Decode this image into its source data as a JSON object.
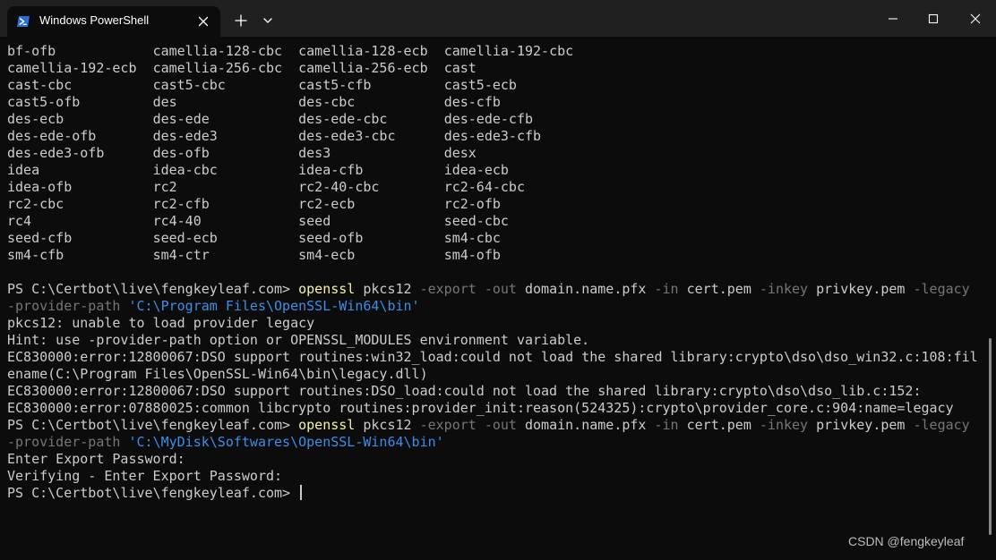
{
  "window": {
    "tab_title": "Windows PowerShell",
    "icons": {
      "tab": "powershell-icon",
      "tab_close": "close-icon",
      "new_tab": "plus-icon",
      "dropdown": "chevron-down-icon",
      "minimize": "minimize-icon",
      "maximize": "maximize-icon",
      "close": "close-icon"
    },
    "colors": {
      "titlebar": "#202020",
      "background": "#0c0c0c",
      "text": "#cccccc",
      "command": "#f9f1a5",
      "parameter": "#767676",
      "string": "#3b8eea"
    }
  },
  "cipher_table": [
    [
      "bf-ofb",
      "camellia-128-cbc",
      "camellia-128-ecb",
      "camellia-192-cbc"
    ],
    [
      "camellia-192-ecb",
      "camellia-256-cbc",
      "camellia-256-ecb",
      "cast"
    ],
    [
      "cast-cbc",
      "cast5-cbc",
      "cast5-cfb",
      "cast5-ecb"
    ],
    [
      "cast5-ofb",
      "des",
      "des-cbc",
      "des-cfb"
    ],
    [
      "des-ecb",
      "des-ede",
      "des-ede-cbc",
      "des-ede-cfb"
    ],
    [
      "des-ede-ofb",
      "des-ede3",
      "des-ede3-cbc",
      "des-ede3-cfb"
    ],
    [
      "des-ede3-ofb",
      "des-ofb",
      "des3",
      "desx"
    ],
    [
      "idea",
      "idea-cbc",
      "idea-cfb",
      "idea-ecb"
    ],
    [
      "idea-ofb",
      "rc2",
      "rc2-40-cbc",
      "rc2-64-cbc"
    ],
    [
      "rc2-cbc",
      "rc2-cfb",
      "rc2-ecb",
      "rc2-ofb"
    ],
    [
      "rc4",
      "rc4-40",
      "seed",
      "seed-cbc"
    ],
    [
      "seed-cfb",
      "seed-ecb",
      "seed-ofb",
      "sm4-cbc"
    ],
    [
      "sm4-cfb",
      "sm4-ctr",
      "sm4-ecb",
      "sm4-ofb"
    ]
  ],
  "session": [
    {
      "type": "blank"
    },
    {
      "type": "segments",
      "parts": [
        {
          "k": "text",
          "t": "PS C:\\Certbot\\live\\fengkeyleaf.com> "
        },
        {
          "k": "cmd",
          "t": "openssl"
        },
        {
          "k": "text",
          "t": " pkcs12 "
        },
        {
          "k": "param",
          "t": "-export"
        },
        {
          "k": "text",
          "t": " "
        },
        {
          "k": "param",
          "t": "-out"
        },
        {
          "k": "text",
          "t": " domain.name.pfx "
        },
        {
          "k": "param",
          "t": "-in"
        },
        {
          "k": "text",
          "t": " cert.pem "
        },
        {
          "k": "param",
          "t": "-inkey"
        },
        {
          "k": "text",
          "t": " privkey.pem "
        },
        {
          "k": "param",
          "t": "-legacy"
        }
      ]
    },
    {
      "type": "segments",
      "parts": [
        {
          "k": "param",
          "t": "-provider-path"
        },
        {
          "k": "text",
          "t": " "
        },
        {
          "k": "str",
          "t": "'C:\\Program Files\\OpenSSL-Win64\\bin'"
        }
      ]
    },
    {
      "type": "text",
      "text": "pkcs12: unable to load provider legacy"
    },
    {
      "type": "text",
      "text": "Hint: use -provider-path option or OPENSSL_MODULES environment variable."
    },
    {
      "type": "text",
      "text": "EC830000:error:12800067:DSO support routines:win32_load:could not load the shared library:crypto\\dso\\dso_win32.c:108:fil"
    },
    {
      "type": "text",
      "text": "ename(C:\\Program Files\\OpenSSL-Win64\\bin\\legacy.dll)"
    },
    {
      "type": "text",
      "text": "EC830000:error:12800067:DSO support routines:DSO_load:could not load the shared library:crypto\\dso\\dso_lib.c:152:"
    },
    {
      "type": "text",
      "text": "EC830000:error:07880025:common libcrypto routines:provider_init:reason(524325):crypto\\provider_core.c:904:name=legacy"
    },
    {
      "type": "segments",
      "parts": [
        {
          "k": "text",
          "t": "PS C:\\Certbot\\live\\fengkeyleaf.com> "
        },
        {
          "k": "cmd",
          "t": "openssl"
        },
        {
          "k": "text",
          "t": " pkcs12 "
        },
        {
          "k": "param",
          "t": "-export"
        },
        {
          "k": "text",
          "t": " "
        },
        {
          "k": "param",
          "t": "-out"
        },
        {
          "k": "text",
          "t": " domain.name.pfx "
        },
        {
          "k": "param",
          "t": "-in"
        },
        {
          "k": "text",
          "t": " cert.pem "
        },
        {
          "k": "param",
          "t": "-inkey"
        },
        {
          "k": "text",
          "t": " privkey.pem "
        },
        {
          "k": "param",
          "t": "-legacy"
        }
      ]
    },
    {
      "type": "segments",
      "parts": [
        {
          "k": "param",
          "t": "-provider-path"
        },
        {
          "k": "text",
          "t": " "
        },
        {
          "k": "str",
          "t": "'C:\\MyDisk\\Softwares\\OpenSSL-Win64\\bin'"
        }
      ]
    },
    {
      "type": "text",
      "text": "Enter Export Password:"
    },
    {
      "type": "text",
      "text": "Verifying - Enter Export Password:"
    },
    {
      "type": "prompt",
      "text": "PS C:\\Certbot\\live\\fengkeyleaf.com> "
    }
  ],
  "watermark": "CSDN @fengkeyleaf"
}
